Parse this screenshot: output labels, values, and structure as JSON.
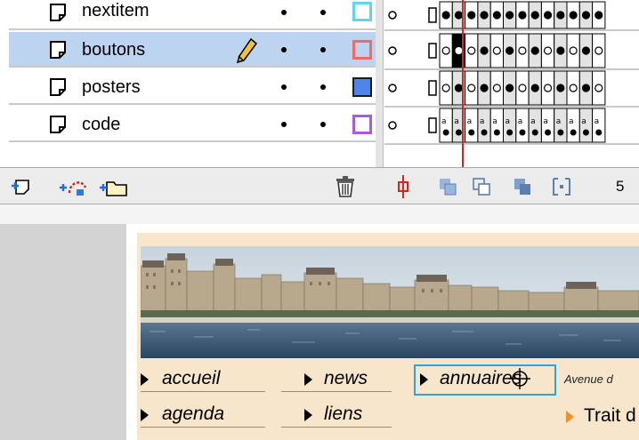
{
  "layers": [
    {
      "name": "nextitem",
      "color": "#5fd6f0",
      "selected": false
    },
    {
      "name": "boutons",
      "color": "#f06a6a",
      "selected": true
    },
    {
      "name": "posters",
      "color": "#4f84e8",
      "selected": false
    },
    {
      "name": "code",
      "color": "#a95cd6",
      "selected": false
    }
  ],
  "colors": {
    "playhead": "#d9231f",
    "selected_row": "#bcd4f0",
    "movie_bg": "#f7e6cb",
    "selection": "#2ea3e0"
  },
  "timeline": {
    "frame_number": "5"
  },
  "toolbar_icons": [
    "insert-layer-icon",
    "add-motion-guide-icon",
    "insert-folder-icon",
    "trash-icon",
    "center-frame-icon",
    "onion-skin-icon",
    "onion-skin-outlines-icon",
    "edit-multiple-frames-icon",
    "modify-onion-markers-icon"
  ],
  "stage": {
    "nav": {
      "accueil": "accueil",
      "news": "news",
      "annuaires": "annuaires",
      "agenda": "agenda",
      "liens": "liens"
    },
    "address_text": "Avenue d",
    "trait_text": "Trait d"
  }
}
